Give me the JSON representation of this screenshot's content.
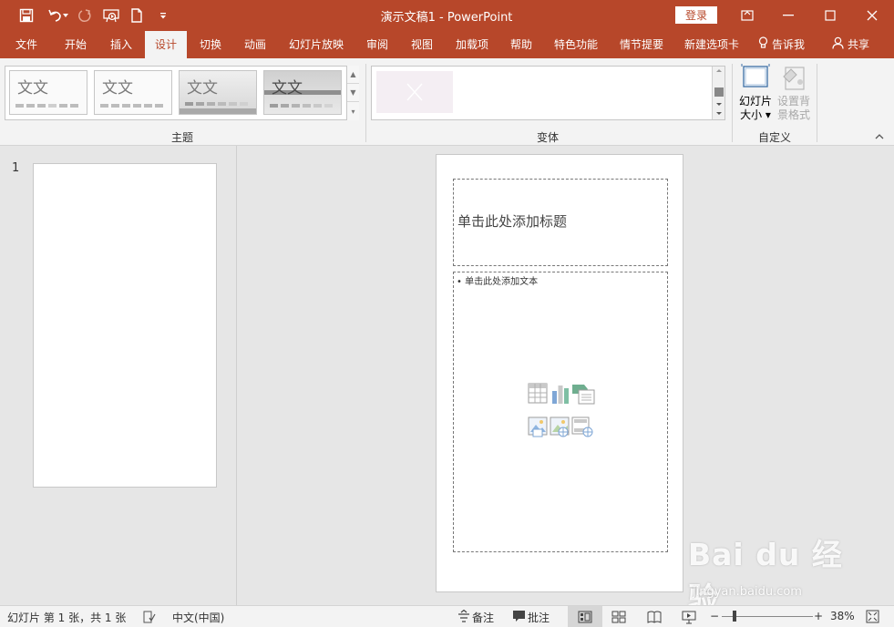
{
  "titlebar": {
    "doc_title": "演示文稿1 - PowerPoint",
    "login_label": "登录"
  },
  "quick_access": [
    "save-icon",
    "undo-icon",
    "redo-icon",
    "present-from-start-icon",
    "new-document-icon",
    "customize-dropdown-icon"
  ],
  "menu": {
    "tabs": [
      {
        "label": "文件"
      },
      {
        "label": "开始"
      },
      {
        "label": "插入"
      },
      {
        "label": "设计"
      },
      {
        "label": "切换"
      },
      {
        "label": "动画"
      },
      {
        "label": "幻灯片放映"
      },
      {
        "label": "审阅"
      },
      {
        "label": "视图"
      },
      {
        "label": "加载项"
      },
      {
        "label": "帮助"
      },
      {
        "label": "特色功能"
      },
      {
        "label": "情节提要"
      },
      {
        "label": "新建选项卡"
      },
      {
        "label": "告诉我"
      },
      {
        "label": "共享"
      }
    ],
    "active_tab": "设计"
  },
  "ribbon": {
    "themes_group_label": "主题",
    "theme_sample_text": "文文",
    "theme_sample_text_4": "文文",
    "variants_group_label": "变体",
    "customize_group_label": "自定义",
    "slide_size_label_1": "幻灯片",
    "slide_size_label_2": "大小",
    "format_bg_label_1": "设置背",
    "format_bg_label_2": "景格式"
  },
  "thumbnails": {
    "slide_number": "1"
  },
  "slide": {
    "title_placeholder": "单击此处添加标题",
    "body_placeholder": "• 单击此处添加文本"
  },
  "statusbar": {
    "slide_info": "幻灯片 第 1 张，共 1 张",
    "language": "中文(中国)",
    "notes_label": "备注",
    "comments_label": "批注",
    "zoom_percent": "38%"
  },
  "watermark": {
    "logo_text": "Bai du 经验",
    "url": "jingyan.baidu.com"
  },
  "colors": {
    "accent": "#b7472a",
    "ribbon_bg": "#f3f3f3",
    "workspace_bg": "#e6e6e6"
  }
}
